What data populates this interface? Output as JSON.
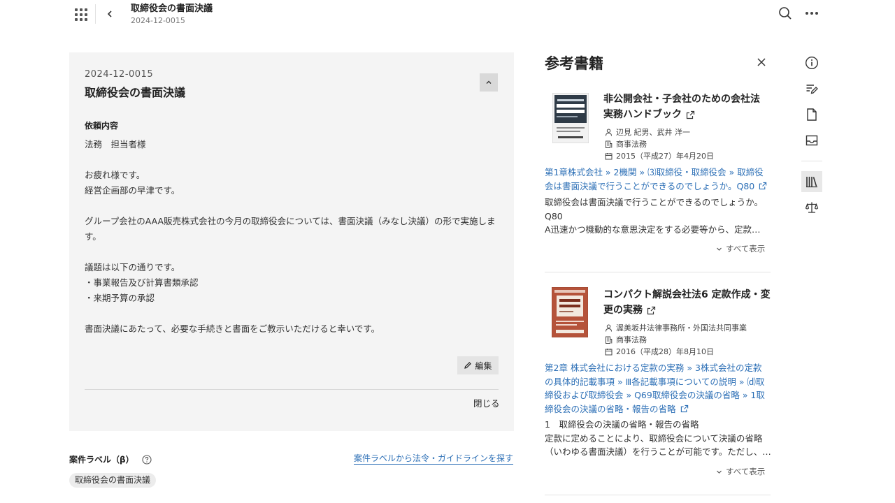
{
  "header": {
    "title": "取締役会の書面決議",
    "subtitle": "2024-12-0015"
  },
  "request": {
    "id": "2024-12-0015",
    "title": "取締役会の書面決議",
    "section_label": "依頼内容",
    "body_lines": [
      "法務　担当者様",
      "",
      "お疲れ様です。",
      "経営企画部の早津です。",
      "",
      "グループ会社のAAA販売株式会社の今月の取締役会については、書面決議（みなし決議）の形で実施しま",
      "す。",
      "",
      "議題は以下の通りです。",
      "・事業報告及び計算書類承認",
      "・来期予算の承認",
      "",
      "書面決議にあたって、必要な手続きと書面をご教示いただけると幸いです。"
    ],
    "edit_label": "編集",
    "close_label": "閉じる"
  },
  "case_label": {
    "label": "案件ラベル（β）",
    "link": "案件ラベルから法令・ガイドラインを探す",
    "tags": [
      "取締役会の書面決議"
    ]
  },
  "panel": {
    "title": "参考書籍",
    "books": [
      {
        "title_lines": [
          "非公開会社・子会社のための会社法",
          "実務ハンドブック"
        ],
        "author": "辺見 紀男、武井 洋一",
        "publisher": "商事法務",
        "date": "2015（平成27）年4月20日",
        "chapter_lines": [
          "第1章株式会社 » 2機関 » ⑶取締役・取締役会 » 取締役",
          "会は書面決議で行うことができるのでしょうか。Q80"
        ],
        "excerpt_lines": [
          "取締役会は書面決議で行うことができるのでしょうか。",
          "Q80",
          "A迅速かつ機動的な意思決定をする必要等から、定款…"
        ],
        "show_all": "すべて表示"
      },
      {
        "title_lines": [
          "コンパクト解説会社法6 定款作成・変",
          "更の実務"
        ],
        "author": "渥美坂井法律事務所・外国法共同事業",
        "publisher": "商事法務",
        "date": "2016（平成28）年8月10日",
        "chapter_lines": [
          "第2章 株式会社における定款の実務 » 3株式会社の定款",
          "の具体的記載事項 » Ⅲ各記載事項についての説明 » ⒟取",
          "締役および取締役会 » Q69取締役会の決議の省略 » 1取",
          "締役会の決議の省略・報告の省略"
        ],
        "excerpt_lines": [
          "1　取締役会の決議の省略・報告の省略",
          "定款に定めることにより、取締役会について決議の省略",
          "（いわゆる書面決議）を行うことが可能です。ただし、…"
        ],
        "show_all": "すべて表示"
      }
    ]
  },
  "colors": {
    "link": "#2c6fb6",
    "card_bg": "#f4f4f4"
  },
  "icons": {
    "rail": [
      "info-icon",
      "edit-note-icon",
      "document-icon",
      "inbox-icon",
      "books-icon",
      "scale-icon"
    ]
  }
}
